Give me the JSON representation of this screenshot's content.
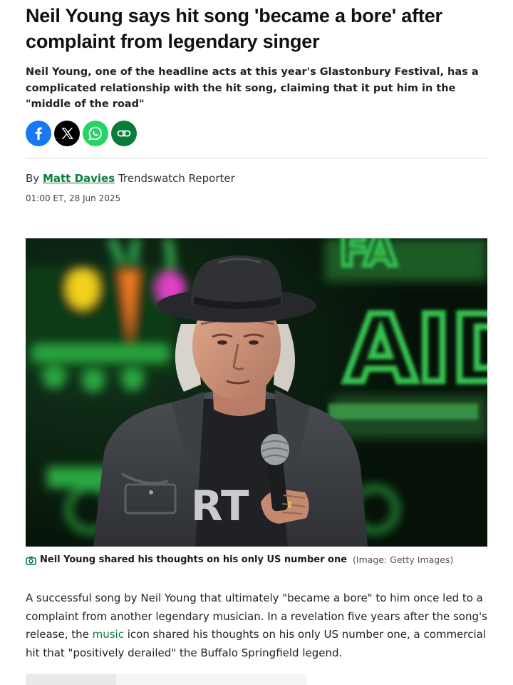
{
  "article": {
    "headline": "Neil Young says hit song 'became a bore' after complaint from legendary singer",
    "standfirst": "Neil Young, one of the headline acts at this year's Glastonbury Festival, has a complicated relationship with the hit song, claiming that it put him in the \"middle of the road\"",
    "byline": {
      "prefix": "By",
      "author": "Matt Davies",
      "role": "Trendswatch Reporter"
    },
    "timestamp": "01:00 ET, 28 Jun 2025",
    "share": {
      "buttons": [
        {
          "name": "facebook",
          "icon": "facebook-icon",
          "color": "#1877f2"
        },
        {
          "name": "x",
          "icon": "x-icon",
          "color": "#000000"
        },
        {
          "name": "whatsapp",
          "icon": "whatsapp-icon",
          "color": "#25d366"
        },
        {
          "name": "copy-link",
          "icon": "link-icon",
          "color": "#0a7c3a"
        }
      ]
    },
    "image": {
      "caption": "Neil Young shared his thoughts on his only US number one",
      "credit": "(Image: Getty Images)",
      "shirt_text": "RT",
      "backdrop_text": "AID"
    },
    "body": {
      "p1_before": "A successful song by Neil Young that ultimately \"became a bore\" to him once led to a complaint from another legendary musician. In a revelation five years after the song's release, the ",
      "p1_link": "music",
      "p1_after": " icon shared his thoughts on his only US number one, a commercial hit that \"positively derailed\" the Buffalo Springfield legend."
    }
  },
  "colors": {
    "accent_green": "#0a7c3a",
    "text": "#1a1a1a"
  }
}
